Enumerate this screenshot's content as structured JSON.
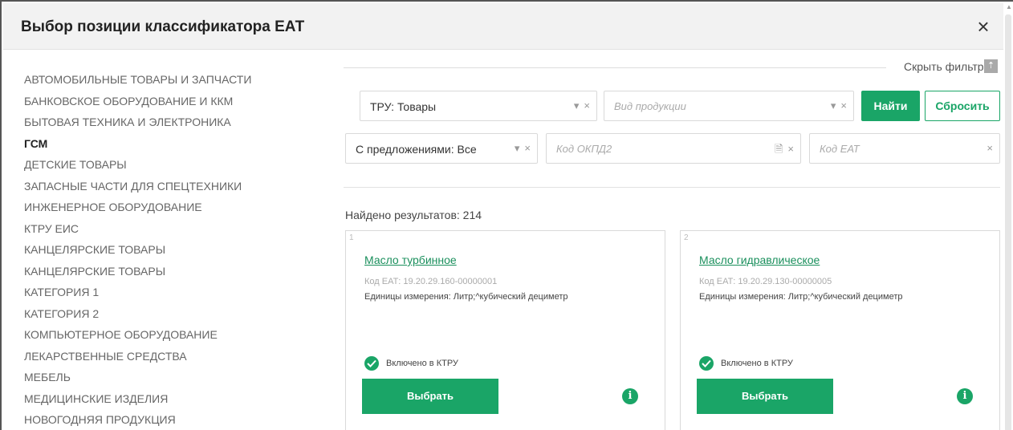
{
  "dialog": {
    "title": "Выбор позиции классификатора ЕАТ",
    "close_glyph": "×"
  },
  "categories": [
    {
      "label": "Автомобильные товары и запчасти",
      "active": false
    },
    {
      "label": "Банковское оборудование и ККМ",
      "active": false
    },
    {
      "label": "Бытовая техника и электроника",
      "active": false
    },
    {
      "label": "ГСМ",
      "active": true
    },
    {
      "label": "Детские товары",
      "active": false
    },
    {
      "label": "Запасные части для спецтехники",
      "active": false
    },
    {
      "label": "Инженерное оборудование",
      "active": false
    },
    {
      "label": "КТРУ ЕИС",
      "active": false
    },
    {
      "label": "Канцелярские товары",
      "active": false
    },
    {
      "label": "Канцелярские товары",
      "active": false
    },
    {
      "label": "Категория 1",
      "active": false
    },
    {
      "label": "Категория 2",
      "active": false
    },
    {
      "label": "Компьютерное оборудование",
      "active": false
    },
    {
      "label": "Лекарственные средства",
      "active": false
    },
    {
      "label": "Мебель",
      "active": false
    },
    {
      "label": "Медицинские изделия",
      "active": false
    },
    {
      "label": "Новогодняя продукция",
      "active": false
    }
  ],
  "filter": {
    "hide_label": "Скрыть фильтр",
    "hide_icon": "collapse-up-icon",
    "tru_value": "ТРУ: Товары",
    "product_type_placeholder": "Вид продукции",
    "offers_value": "С предложениями: Все",
    "okpd2_placeholder": "Код ОКПД2",
    "eat_code_placeholder": "Код ЕАТ",
    "find_label": "Найти",
    "reset_label": "Сбросить",
    "dropdown_glyph": "▾",
    "clear_glyph": "×",
    "doc_glyph": "🗎"
  },
  "results": {
    "count_label": "Найдено результатов: 214",
    "cards": [
      {
        "num": "1",
        "title": "Масло турбинное",
        "code": "Код ЕАТ: 19.20.29.160-00000001",
        "units": "Единицы измерения: Литр;^кубический дециметр",
        "status": "Включено в КТРУ",
        "button": "Выбрать",
        "info": "i"
      },
      {
        "num": "2",
        "title": "Масло гидравлическое",
        "code": "Код ЕАТ: 19.20.29.130-00000005",
        "units": "Единицы измерения: Литр;^кубический дециметр",
        "status": "Включено в КТРУ",
        "button": "Выбрать",
        "info": "i"
      }
    ]
  },
  "colors": {
    "accent": "#1aa567",
    "link": "#1a8f5c",
    "header_bg": "#f2f2f2"
  }
}
